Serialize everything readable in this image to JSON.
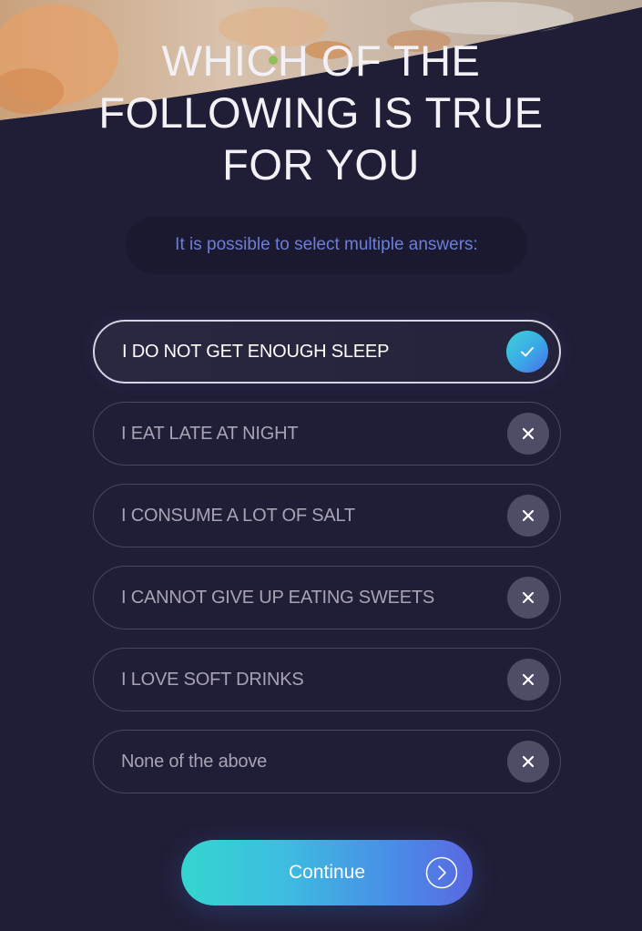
{
  "header": {
    "title": "WHICH OF THE\nFOLLOWING IS TRUE\nFOR YOU"
  },
  "hint": "It is possible to select multiple answers:",
  "options": [
    {
      "label": "I DO NOT GET ENOUGH SLEEP",
      "selected": true,
      "icon": "check-icon"
    },
    {
      "label": "I EAT LATE AT NIGHT",
      "selected": false,
      "icon": "close-icon"
    },
    {
      "label": "I CONSUME A LOT OF SALT",
      "selected": false,
      "icon": "close-icon"
    },
    {
      "label": "I CANNOT GIVE UP EATING SWEETS",
      "selected": false,
      "icon": "close-icon"
    },
    {
      "label": "I LOVE SOFT DRINKS",
      "selected": false,
      "icon": "close-icon"
    },
    {
      "label": "None of the above",
      "selected": false,
      "icon": "close-icon"
    }
  ],
  "continue_button": {
    "label": "Continue",
    "icon": "chevron-right-circle-icon"
  },
  "colors": {
    "background": "#201e36",
    "accent_gradient_start": "#34d6cf",
    "accent_gradient_end": "#5a68e2",
    "hint_text": "#6d7ed6"
  }
}
